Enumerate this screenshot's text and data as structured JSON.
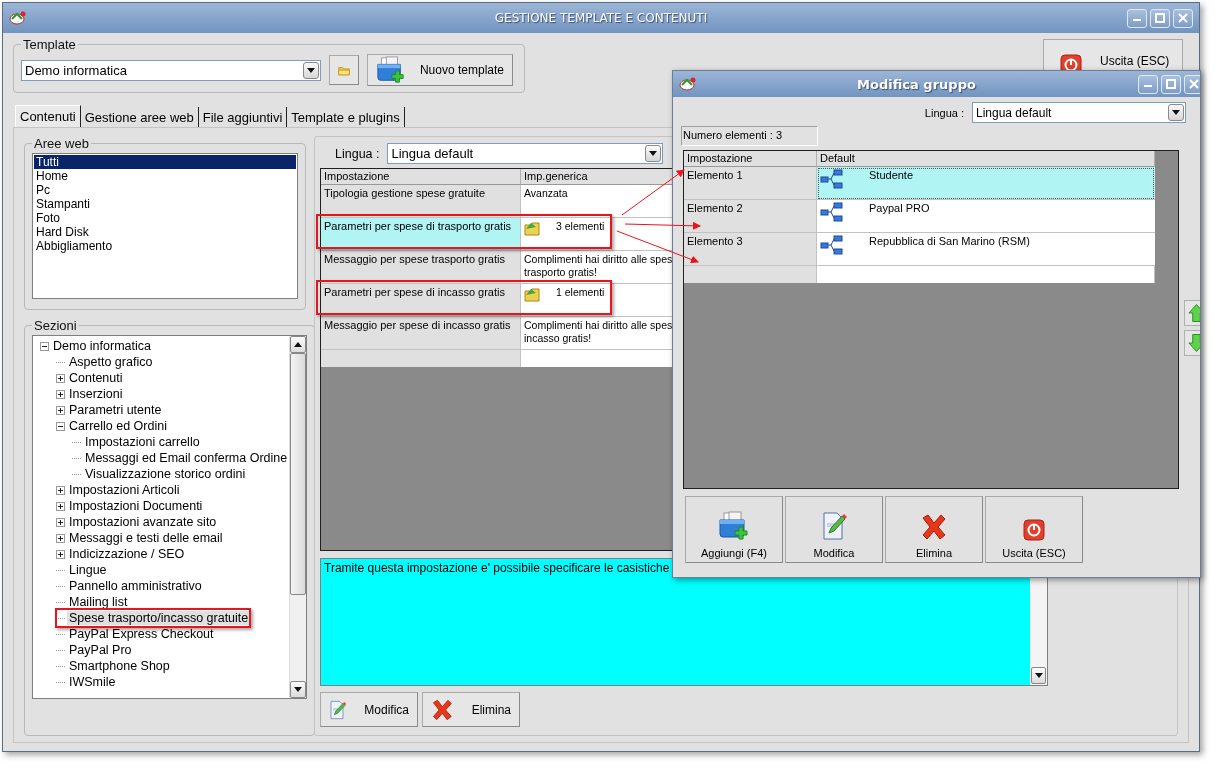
{
  "window": {
    "title": "GESTIONE TEMPLATE E CONTENUTI"
  },
  "template": {
    "label": "Template",
    "value": "Demo informatica",
    "new_button": "Nuovo template"
  },
  "exit_button": "Uscita (ESC)",
  "tabs": [
    {
      "label": "Contenuti",
      "selected": true
    },
    {
      "label": "Gestione aree web",
      "selected": false
    },
    {
      "label": "File aggiuntivi",
      "selected": false
    },
    {
      "label": "Template e plugins",
      "selected": false
    }
  ],
  "web_areas": {
    "label": "Aree web",
    "items": [
      {
        "label": "Tutti",
        "selected": true
      },
      {
        "label": "Home",
        "selected": false
      },
      {
        "label": "Pc",
        "selected": false
      },
      {
        "label": "Stampanti",
        "selected": false
      },
      {
        "label": "Foto",
        "selected": false
      },
      {
        "label": "Hard Disk",
        "selected": false
      },
      {
        "label": "Abbigliamento",
        "selected": false
      }
    ]
  },
  "sections": {
    "label": "Sezioni",
    "tree": [
      {
        "label": "Demo informatica",
        "expanded": true,
        "selected": false,
        "annotated": false,
        "children": [
          {
            "label": "Aspetto grafico",
            "selected": false,
            "annotated": false
          },
          {
            "label": "Contenuti",
            "expanded": false,
            "selected": false,
            "annotated": false
          },
          {
            "label": "Inserzioni",
            "expanded": false,
            "selected": false,
            "annotated": false
          },
          {
            "label": "Parametri utente",
            "expanded": false,
            "selected": false,
            "annotated": false
          },
          {
            "label": "Carrello ed Ordini",
            "expanded": true,
            "selected": false,
            "annotated": false,
            "children": [
              {
                "label": "Impostazioni carrello",
                "selected": false,
                "annotated": false
              },
              {
                "label": "Messaggi ed Email conferma Ordine",
                "selected": false,
                "annotated": false
              },
              {
                "label": "Visualizzazione storico ordini",
                "selected": false,
                "annotated": false
              }
            ]
          },
          {
            "label": "Impostazioni Articoli",
            "expanded": false,
            "selected": false,
            "annotated": false
          },
          {
            "label": "Impostazioni Documenti",
            "expanded": false,
            "selected": false,
            "annotated": false
          },
          {
            "label": "Impostazioni avanzate sito",
            "expanded": false,
            "selected": false,
            "annotated": false
          },
          {
            "label": "Messaggi e testi delle email",
            "expanded": false,
            "selected": false,
            "annotated": false
          },
          {
            "label": "Indicizzazione / SEO",
            "expanded": false,
            "selected": false,
            "annotated": false
          },
          {
            "label": "Lingue",
            "selected": false,
            "annotated": false
          },
          {
            "label": "Pannello amministrativo",
            "selected": false,
            "annotated": false
          },
          {
            "label": "Mailing list",
            "selected": false,
            "annotated": false
          },
          {
            "label": "Spese trasporto/incasso gratuite",
            "selected": true,
            "annotated": true
          },
          {
            "label": "PayPal Express Checkout",
            "selected": false,
            "annotated": false
          },
          {
            "label": "PayPal Pro",
            "selected": false,
            "annotated": false
          },
          {
            "label": "Smartphone Shop",
            "selected": false,
            "annotated": false
          },
          {
            "label": "IWSmile",
            "selected": false,
            "annotated": false
          }
        ]
      }
    ]
  },
  "content": {
    "language_label": "Lingua :",
    "language": "Lingua default",
    "columns": [
      "Impostazione",
      "Imp.generica"
    ],
    "rows": [
      {
        "setting": "Tipologia gestione spese gratuite",
        "value": "Avanzata",
        "kind": "text",
        "selected": false,
        "annotated": false
      },
      {
        "setting": "Parametri per spese di trasporto gratis",
        "value": "3 elementi",
        "kind": "group",
        "selected": true,
        "annotated": true
      },
      {
        "setting": "Messaggio per spese trasporto gratis",
        "value": "Complimenti hai diritto alle spes\ntrasporto gratis!",
        "kind": "text",
        "selected": false,
        "annotated": false
      },
      {
        "setting": "Parametri per spese di incasso gratis",
        "value": "1 elementi",
        "kind": "group",
        "selected": false,
        "annotated": true
      },
      {
        "setting": "Messaggio per spese di incasso gratis",
        "value": "Complimenti hai diritto alle spes\nincasso gratis!",
        "kind": "text",
        "selected": false,
        "annotated": false
      }
    ],
    "description": "Tramite questa impostazione e' possibile specificare le casistiche",
    "buttons": [
      {
        "label": "Modifica",
        "kind": "edit"
      },
      {
        "label": "Elimina",
        "kind": "delete"
      }
    ]
  },
  "dialog": {
    "title": "Modifica gruppo",
    "language_label": "Lingua :",
    "language": "Lingua default",
    "count": "Numero elementi : 3",
    "columns": [
      "Impostazione",
      "Default"
    ],
    "rows": [
      {
        "setting": "Elemento 1",
        "value": "Studente",
        "selected": true
      },
      {
        "setting": "Elemento 2",
        "value": "Paypal PRO",
        "selected": false
      },
      {
        "setting": "Elemento 3",
        "value": "Repubblica di San Marino (RSM)",
        "selected": false
      }
    ],
    "buttons": [
      {
        "label": "Aggiungi (F4)",
        "kind": "add"
      },
      {
        "label": "Modifica",
        "kind": "edit"
      },
      {
        "label": "Elimina",
        "kind": "delete"
      },
      {
        "label": "Uscita (ESC)",
        "kind": "exit"
      }
    ]
  }
}
